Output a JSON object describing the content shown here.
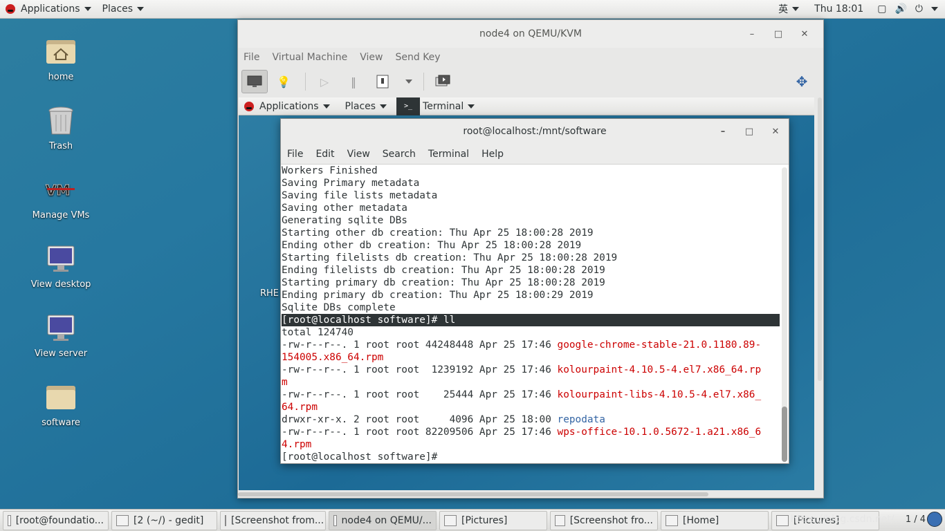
{
  "topbar": {
    "applications": "Applications",
    "places": "Places",
    "input_method": "英",
    "clock": "Thu 18:01"
  },
  "desktop": {
    "icons": [
      {
        "label": "home",
        "icon": "home-folder-icon"
      },
      {
        "label": "Trash",
        "icon": "trash-icon"
      },
      {
        "label": "Manage VMs",
        "icon": "virt-manager-icon"
      },
      {
        "label": "View desktop",
        "icon": "monitor-icon"
      },
      {
        "label": "View server",
        "icon": "monitor-icon"
      },
      {
        "label": "software",
        "icon": "folder-icon"
      }
    ]
  },
  "vm_window": {
    "title": "node4 on QEMU/KVM",
    "menu": [
      "File",
      "Virtual Machine",
      "View",
      "Send Key"
    ]
  },
  "guest": {
    "applications": "Applications",
    "places": "Places",
    "terminal": "Terminal",
    "desktop_label": "RHE"
  },
  "terminal": {
    "title": "root@localhost:/mnt/software",
    "menu": [
      "File",
      "Edit",
      "View",
      "Search",
      "Terminal",
      "Help"
    ],
    "lines": [
      {
        "text": "Workers Finished"
      },
      {
        "text": "Saving Primary metadata"
      },
      {
        "text": "Saving file lists metadata"
      },
      {
        "text": "Saving other metadata"
      },
      {
        "text": "Generating sqlite DBs"
      },
      {
        "text": "Starting other db creation: Thu Apr 25 18:00:28 2019"
      },
      {
        "text": "Ending other db creation: Thu Apr 25 18:00:28 2019"
      },
      {
        "text": "Starting filelists db creation: Thu Apr 25 18:00:28 2019"
      },
      {
        "text": "Ending filelists db creation: Thu Apr 25 18:00:28 2019"
      },
      {
        "text": "Starting primary db creation: Thu Apr 25 18:00:28 2019"
      },
      {
        "text": "Ending primary db creation: Thu Apr 25 18:00:29 2019"
      },
      {
        "text": "Sqlite DBs complete"
      },
      {
        "text": "[root@localhost software]# ll",
        "highlight": true
      },
      {
        "text": "total 124740"
      },
      {
        "prefix": "-rw-r--r--. 1 root root 44248448 Apr 25 17:46 ",
        "name": "google-chrome-stable-21.0.1180.89-",
        "color": "red"
      },
      {
        "name": "154005.x86_64.rpm",
        "color": "red"
      },
      {
        "prefix": "-rw-r--r--. 1 root root  1239192 Apr 25 17:46 ",
        "name": "kolourpaint-4.10.5-4.el7.x86_64.rp",
        "color": "red"
      },
      {
        "name": "m",
        "color": "red"
      },
      {
        "prefix": "-rw-r--r--. 1 root root    25444 Apr 25 17:46 ",
        "name": "kolourpaint-libs-4.10.5-4.el7.x86_",
        "color": "red"
      },
      {
        "name": "64.rpm",
        "color": "red"
      },
      {
        "prefix": "drwxr-xr-x. 2 root root     4096 Apr 25 18:00 ",
        "name": "repodata",
        "color": "blue"
      },
      {
        "prefix": "-rw-r--r--. 1 root root 82209506 Apr 25 17:46 ",
        "name": "wps-office-10.1.0.5672-1.a21.x86_6",
        "color": "red"
      },
      {
        "name": "4.rpm",
        "color": "red"
      },
      {
        "text": "[root@localhost software]# "
      }
    ]
  },
  "taskbar": {
    "tasks": [
      {
        "label": "[root@foundatio...",
        "icon": "terminal-icon"
      },
      {
        "label": "[2 (~/) - gedit]",
        "icon": "text-editor-icon"
      },
      {
        "label": "[Screenshot from...",
        "icon": "screenshot-icon"
      },
      {
        "label": "node4 on QEMU/...",
        "icon": "virt-manager-icon",
        "active": true
      },
      {
        "label": "[Pictures]",
        "icon": "file-manager-icon"
      },
      {
        "label": "[Screenshot fro...",
        "icon": "screenshot-icon"
      },
      {
        "label": "[Home]",
        "icon": "file-manager-icon"
      },
      {
        "label": "[Pictures]",
        "icon": "file-manager-icon"
      }
    ],
    "watermark": "https://blog.csdn.net/...",
    "workspace": "1 / 4"
  }
}
